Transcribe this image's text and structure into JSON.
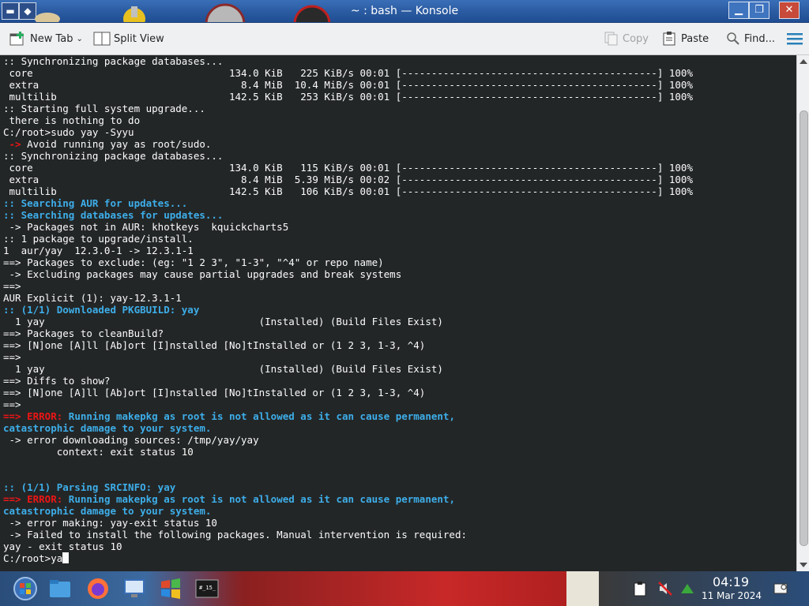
{
  "window": {
    "title": "~ : bash — Konsole",
    "buttons": {
      "minimize": "▁",
      "maximize": "❐",
      "close": "✕"
    }
  },
  "toolbar": {
    "new_tab": "New Tab",
    "split_view": "Split View",
    "copy": "Copy",
    "paste": "Paste",
    "find": "Find..."
  },
  "terminal": {
    "lines": [
      {
        "segments": [
          {
            "t": ":: Synchronizing package databases...",
            "c": "white"
          }
        ]
      },
      {
        "segments": [
          {
            "t": " core                                 134.0 KiB   225 KiB/s 00:01 [-------------------------------------------] 100%",
            "c": "white"
          }
        ]
      },
      {
        "segments": [
          {
            "t": " extra                                  8.4 MiB  10.4 MiB/s 00:01 [-------------------------------------------] 100%",
            "c": "white"
          }
        ]
      },
      {
        "segments": [
          {
            "t": " multilib                             142.5 KiB   253 KiB/s 00:01 [-------------------------------------------] 100%",
            "c": "white"
          }
        ]
      },
      {
        "segments": [
          {
            "t": ":: Starting full system upgrade...",
            "c": "white"
          }
        ]
      },
      {
        "segments": [
          {
            "t": " there is nothing to do",
            "c": "white"
          }
        ]
      },
      {
        "segments": [
          {
            "t": "C:/root>sudo yay -Syyu",
            "c": "white"
          }
        ]
      },
      {
        "segments": [
          {
            "t": " -> ",
            "c": "red"
          },
          {
            "t": "Avoid running yay as root/sudo.",
            "c": "white"
          }
        ]
      },
      {
        "segments": [
          {
            "t": ":: Synchronizing package databases...",
            "c": "white"
          }
        ]
      },
      {
        "segments": [
          {
            "t": " core                                 134.0 KiB   115 KiB/s 00:01 [-------------------------------------------] 100%",
            "c": "white"
          }
        ]
      },
      {
        "segments": [
          {
            "t": " extra                                  8.4 MiB  5.39 MiB/s 00:02 [-------------------------------------------] 100%",
            "c": "white"
          }
        ]
      },
      {
        "segments": [
          {
            "t": " multilib                             142.5 KiB   106 KiB/s 00:01 [-------------------------------------------] 100%",
            "c": "white"
          }
        ]
      },
      {
        "segments": [
          {
            "t": ":: Searching AUR for updates...",
            "c": "blue"
          }
        ]
      },
      {
        "segments": [
          {
            "t": ":: Searching databases for updates...",
            "c": "blue"
          }
        ]
      },
      {
        "segments": [
          {
            "t": " -> Packages not in AUR: khotkeys  kquickcharts5",
            "c": "white"
          }
        ]
      },
      {
        "segments": [
          {
            "t": ":: 1 package to upgrade/install.",
            "c": "white"
          }
        ]
      },
      {
        "segments": [
          {
            "t": "1  aur/yay  12.3.0-1 -> 12.3.1-1",
            "c": "white"
          }
        ]
      },
      {
        "segments": [
          {
            "t": "==> Packages to exclude: (eg: \"1 2 3\", \"1-3\", \"^4\" or repo name)",
            "c": "white"
          }
        ]
      },
      {
        "segments": [
          {
            "t": " -> Excluding packages may cause partial upgrades and break systems",
            "c": "white"
          }
        ]
      },
      {
        "segments": [
          {
            "t": "==>",
            "c": "white"
          }
        ]
      },
      {
        "segments": [
          {
            "t": "AUR Explicit (1): yay-12.3.1-1",
            "c": "white"
          }
        ]
      },
      {
        "segments": [
          {
            "t": ":: (1/1) Downloaded PKGBUILD: yay",
            "c": "blue"
          }
        ]
      },
      {
        "segments": [
          {
            "t": "  1 yay                                    (Installed) (Build Files Exist)",
            "c": "white"
          }
        ]
      },
      {
        "segments": [
          {
            "t": "==> Packages to cleanBuild?",
            "c": "white"
          }
        ]
      },
      {
        "segments": [
          {
            "t": "==> [N]one [A]ll [Ab]ort [I]nstalled [No]tInstalled or (1 2 3, 1-3, ^4)",
            "c": "white"
          }
        ]
      },
      {
        "segments": [
          {
            "t": "==>",
            "c": "white"
          }
        ]
      },
      {
        "segments": [
          {
            "t": "  1 yay                                    (Installed) (Build Files Exist)",
            "c": "white"
          }
        ]
      },
      {
        "segments": [
          {
            "t": "==> Diffs to show?",
            "c": "white"
          }
        ]
      },
      {
        "segments": [
          {
            "t": "==> [N]one [A]ll [Ab]ort [I]nstalled [No]tInstalled or (1 2 3, 1-3, ^4)",
            "c": "white"
          }
        ]
      },
      {
        "segments": [
          {
            "t": "==>",
            "c": "white"
          }
        ]
      },
      {
        "segments": [
          {
            "t": "==> ERROR: ",
            "c": "red"
          },
          {
            "t": "Running makepkg as root is not allowed as it can cause permanent,",
            "c": "blue"
          }
        ]
      },
      {
        "segments": [
          {
            "t": "catastrophic damage to your system.",
            "c": "blue"
          }
        ]
      },
      {
        "segments": [
          {
            "t": " -> error downloading sources: /tmp/yay/yay",
            "c": "white"
          }
        ]
      },
      {
        "segments": [
          {
            "t": "         context: exit status 10",
            "c": "white"
          }
        ]
      },
      {
        "segments": [
          {
            "t": "",
            "c": "white"
          }
        ]
      },
      {
        "segments": [
          {
            "t": "",
            "c": "white"
          }
        ]
      },
      {
        "segments": [
          {
            "t": ":: (1/1) Parsing SRCINFO: yay",
            "c": "blue"
          }
        ]
      },
      {
        "segments": [
          {
            "t": "==> ERROR: ",
            "c": "red"
          },
          {
            "t": "Running makepkg as root is not allowed as it can cause permanent,",
            "c": "blue"
          }
        ]
      },
      {
        "segments": [
          {
            "t": "catastrophic damage to your system.",
            "c": "blue"
          }
        ]
      },
      {
        "segments": [
          {
            "t": " -> error making: yay-exit status 10",
            "c": "white"
          }
        ]
      },
      {
        "segments": [
          {
            "t": " -> Failed to install the following packages. Manual intervention is required:",
            "c": "white"
          }
        ]
      },
      {
        "segments": [
          {
            "t": "yay - exit status 10",
            "c": "white"
          }
        ]
      }
    ],
    "prompt": "C:/root>ya"
  },
  "taskbar": {
    "apps": [
      "start-orb",
      "file-manager",
      "firefox",
      "remote-desktop",
      "windows-logo",
      "terminal"
    ],
    "clock_time": "04:19",
    "clock_date": "11 Mar 2024"
  }
}
